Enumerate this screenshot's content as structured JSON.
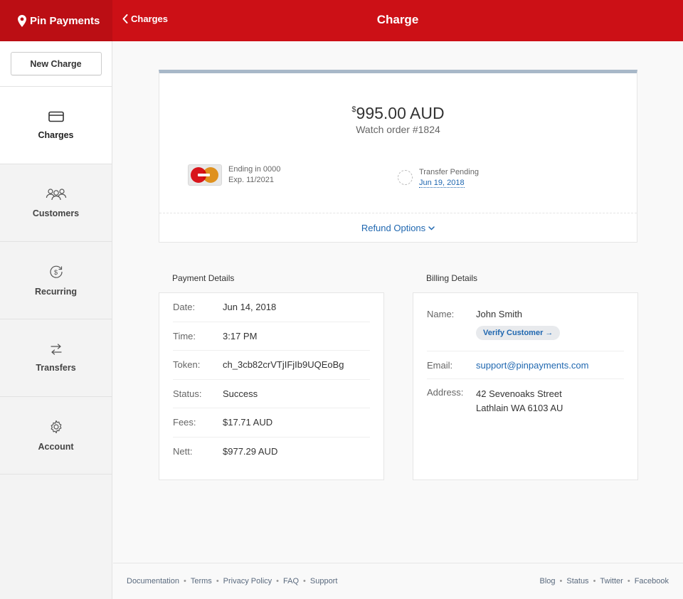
{
  "app": {
    "name": "Pin Payments",
    "back_label": "Charges",
    "page_title": "Charge"
  },
  "sidebar": {
    "new_charge_label": "New Charge",
    "items": [
      {
        "label": "Charges",
        "icon": "credit-card-icon",
        "active": true
      },
      {
        "label": "Customers",
        "icon": "customers-icon",
        "active": false
      },
      {
        "label": "Recurring",
        "icon": "recurring-dollar-icon",
        "active": false
      },
      {
        "label": "Transfers",
        "icon": "transfers-icon",
        "active": false
      },
      {
        "label": "Account",
        "icon": "gear-icon",
        "active": false
      }
    ]
  },
  "charge": {
    "currency_symbol": "$",
    "amount": "995.00 AUD",
    "description": "Watch order #1824",
    "card_ending": "Ending in 0000",
    "card_expiry": "Exp. 11/2021",
    "card_brand_icon": "mastercard-icon",
    "transfer_status": "Transfer Pending",
    "transfer_date": "Jun 19, 2018",
    "refund_label": "Refund Options"
  },
  "payment_details": {
    "title": "Payment Details",
    "rows": [
      {
        "label": "Date:",
        "value": "Jun 14, 2018"
      },
      {
        "label": "Time:",
        "value": "3:17 PM"
      },
      {
        "label": "Token:",
        "value": "ch_3cb82crVTjIFjIb9UQEoBg"
      },
      {
        "label": "Status:",
        "value": "Success"
      },
      {
        "label": "Fees:",
        "value": "$17.71 AUD"
      },
      {
        "label": "Nett:",
        "value": "$977.29 AUD"
      }
    ]
  },
  "billing_details": {
    "title": "Billing Details",
    "name_label": "Name:",
    "name": "John Smith",
    "verify_label": "Verify Customer →",
    "email_label": "Email:",
    "email": "support@pinpayments.com",
    "address_label": "Address:",
    "address_line1": "42 Sevenoaks Street",
    "address_line2": "Lathlain WA 6103 AU"
  },
  "footer": {
    "left_links": [
      "Documentation",
      "Terms",
      "Privacy Policy",
      "FAQ",
      "Support"
    ],
    "right_links": [
      "Blog",
      "Status",
      "Twitter",
      "Facebook"
    ]
  },
  "colors": {
    "brand_red": "#cc1016",
    "link_blue": "#1f67b0"
  }
}
